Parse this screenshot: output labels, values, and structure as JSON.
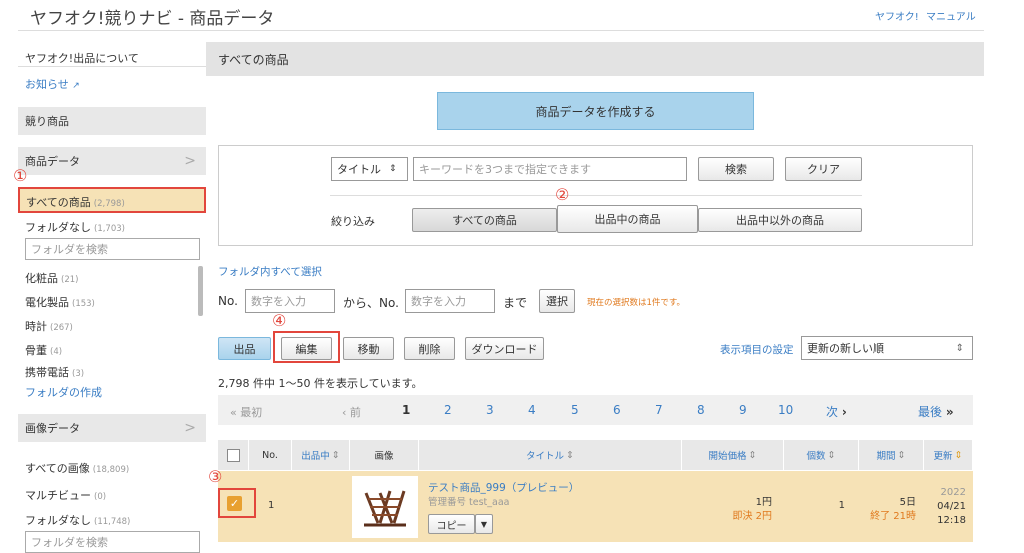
{
  "header": {
    "title": "ヤフオク!競りナビ - 商品データ",
    "links": [
      "ヤフオク!",
      "マニュアル"
    ]
  },
  "sidebar": {
    "about": "ヤフオク!出品について",
    "news": "お知らせ",
    "auction_section": "競り商品",
    "product_data": "商品データ",
    "all_products": {
      "label": "すべての商品",
      "count": "(2,798)"
    },
    "no_folder": {
      "label": "フォルダなし",
      "count": "(1,703)"
    },
    "folder_search_placeholder": "フォルダを検索",
    "folders": [
      {
        "label": "化粧品",
        "count": "(21)"
      },
      {
        "label": "電化製品",
        "count": "(153)"
      },
      {
        "label": "時計",
        "count": "(267)"
      },
      {
        "label": "骨董",
        "count": "(4)"
      },
      {
        "label": "携帯電話",
        "count": "(3)"
      }
    ],
    "create_folder": "フォルダの作成",
    "image_data": "画像データ",
    "all_images": {
      "label": "すべての画像",
      "count": "(18,809)"
    },
    "multi_view": {
      "label": "マルチビュー",
      "count": "(0)"
    },
    "image_no_folder": {
      "label": "フォルダなし",
      "count": "(11,748)"
    },
    "image_folder_search_placeholder": "フォルダを検索"
  },
  "main": {
    "heading": "すべての商品",
    "create_button": "商品データを作成する",
    "search": {
      "field_select": "タイトル",
      "placeholder": "キーワードを3つまで指定できます",
      "search_button": "検索",
      "clear_button": "クリア"
    },
    "filter": {
      "label": "絞り込み",
      "options": [
        "すべての商品",
        "出品中の商品",
        "出品中以外の商品"
      ]
    },
    "select_all_in_folder": "フォルダ内すべて選択",
    "range": {
      "no_label": "No.",
      "from_placeholder": "数字を入力",
      "from_text": "から、No.",
      "to_placeholder": "数字を入力",
      "to_text": "まで",
      "select_button": "選択",
      "selection_note": "現在の選択数は1件です。"
    },
    "actions": {
      "list": "出品",
      "edit": "編集",
      "move": "移動",
      "delete": "削除",
      "download": "ダウンロード"
    },
    "display_settings": "表示項目の設定",
    "sort_value": "更新の新しい順",
    "result_text": "2,798 件中 1〜50 件を表示しています。",
    "pagination": {
      "first": "最初",
      "prev": "前",
      "pages": [
        "1",
        "2",
        "3",
        "4",
        "5",
        "6",
        "7",
        "8",
        "9",
        "10"
      ],
      "next": "次",
      "last": "最後"
    },
    "table": {
      "headers": [
        "No.",
        "出品中",
        "画像",
        "タイトル",
        "開始価格",
        "個数",
        "期間",
        "更新"
      ],
      "rows": [
        {
          "no": "1",
          "title": "テスト商品_999（プレビュー）",
          "mgmt": "管理番号 test_aaa",
          "copy_button": "コピー",
          "price": "1円",
          "buyout": "即決 2円",
          "qty": "1",
          "period": "5日",
          "end": "終了 21時",
          "updated_year": "2022",
          "updated_date": "04/21",
          "updated_time": "12:18"
        }
      ]
    }
  },
  "annotations": {
    "c1": "①",
    "c2": "②",
    "c3": "③",
    "c4": "④"
  }
}
